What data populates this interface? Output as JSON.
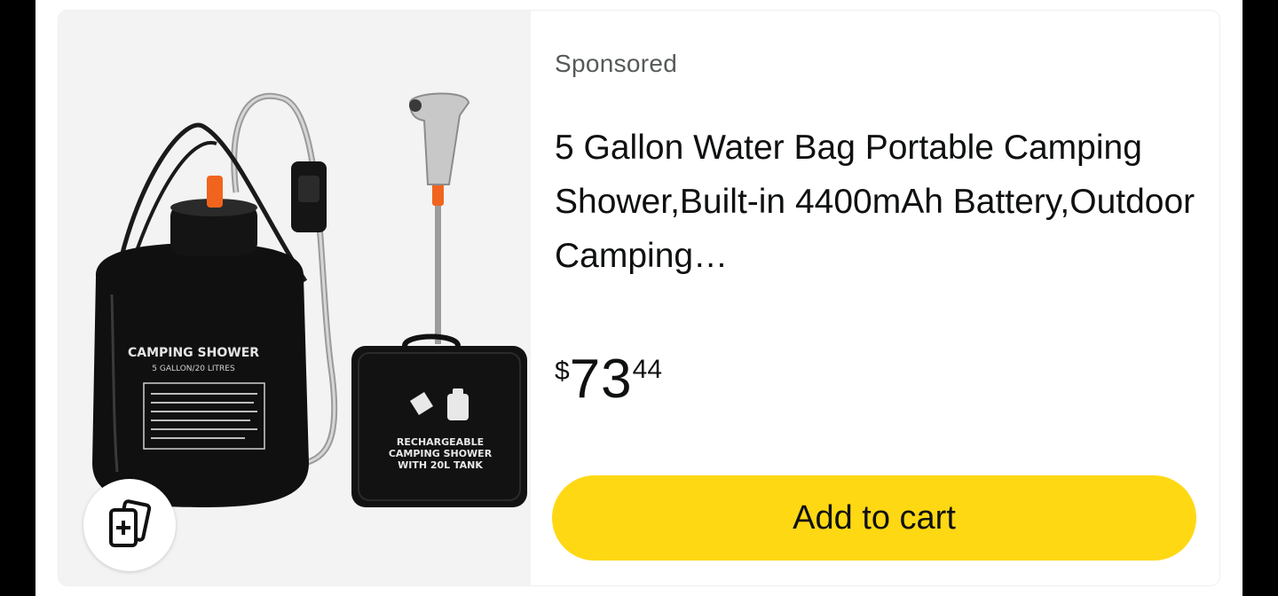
{
  "sponsored_label": "Sponsored",
  "product": {
    "title": "5 Gallon Water Bag Portable Camping Shower,Built-in 4400mAh Battery,Outdoor Camping…",
    "image_text": {
      "bag_title": "CAMPING SHOWER",
      "bag_subtitle": "5 GALLON/20 LITRES",
      "case_text_1": "RECHARGEABLE",
      "case_text_2": "CAMPING SHOWER",
      "case_text_3": "WITH 20L TANK"
    }
  },
  "price": {
    "symbol": "$",
    "whole": "73",
    "fraction": "44"
  },
  "buttons": {
    "add_to_cart": "Add to cart",
    "compare_icon": "compare-cards-icon"
  },
  "colors": {
    "cart_button": "#ffd814",
    "text": "#0f1111",
    "muted_text": "#565959",
    "image_bg": "#f3f3f3",
    "accent_orange": "#f0641e"
  }
}
